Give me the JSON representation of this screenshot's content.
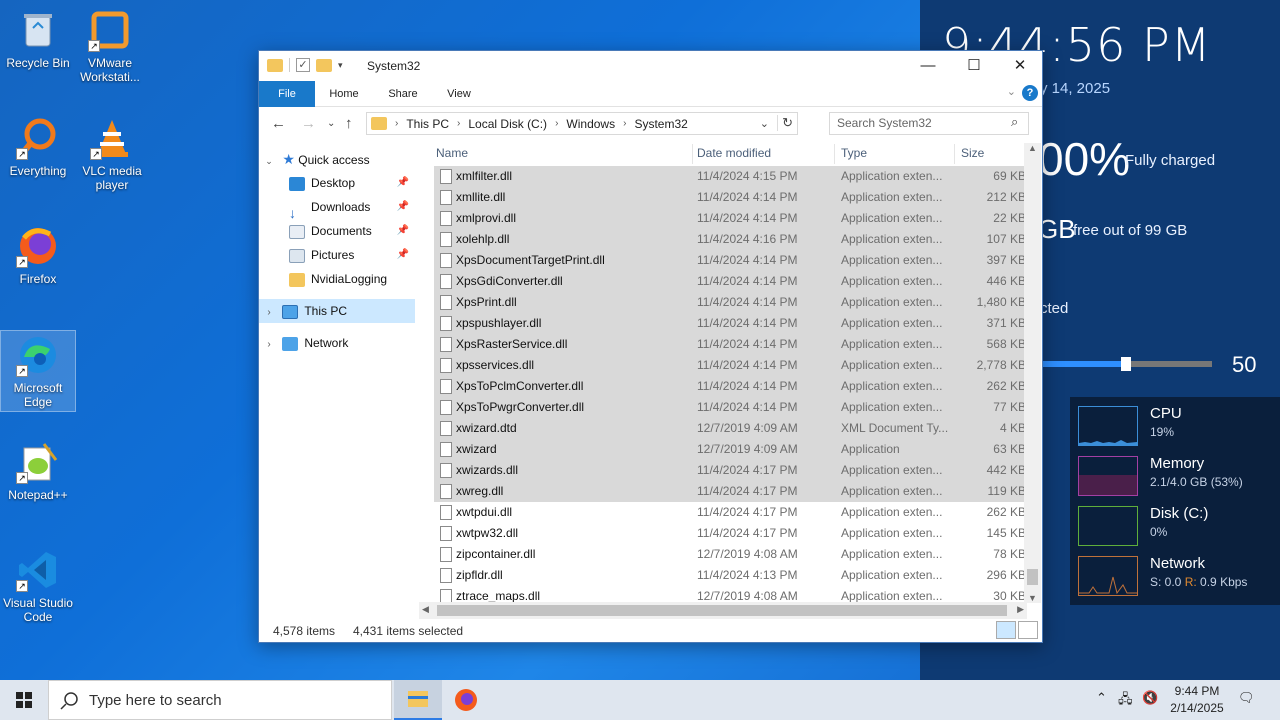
{
  "desktop": {
    "icons": [
      {
        "label": "Recycle Bin",
        "icon": "recycle-bin-icon"
      },
      {
        "label": "VMware Workstati...",
        "icon": "vmware-icon"
      },
      {
        "label": "Everything",
        "icon": "everything-search-icon"
      },
      {
        "label": "VLC media player",
        "icon": "vlc-icon"
      },
      {
        "label": "Firefox",
        "icon": "firefox-icon"
      },
      {
        "label": "Microsoft Edge",
        "icon": "edge-icon"
      },
      {
        "label": "Notepad++",
        "icon": "notepadpp-icon"
      },
      {
        "label": "Visual Studio Code",
        "icon": "vscode-icon"
      }
    ],
    "rainmeter": {
      "time": "9:44:56 PM",
      "date": "y 14, 2025",
      "battery_big": "00%",
      "battery_label": "Fully charged",
      "disk_big": "GB",
      "disk_label": "free out of 99 GB",
      "network_label": "cted",
      "volume": "50",
      "volume_fraction": 0.5
    },
    "perf": [
      {
        "name": "CPU",
        "value": "19%",
        "color": "#3b8ed8"
      },
      {
        "name": "Memory",
        "value": "2.1/4.0 GB (53%)",
        "color": "#a33fa3"
      },
      {
        "name": "Disk (C:)",
        "value": "0%",
        "color": "#5fae3b"
      },
      {
        "name": "Network",
        "value_s": "S: 0.0",
        "value_r_label": "R:",
        "value_r": "0.9 Kbps",
        "color": "#c0713a"
      }
    ]
  },
  "explorer": {
    "title": "System32",
    "ribbon_tabs": [
      "File",
      "Home",
      "Share",
      "View"
    ],
    "breadcrumb": [
      "This PC",
      "Local Disk (C:)",
      "Windows",
      "System32"
    ],
    "search_placeholder": "Search System32",
    "nav": {
      "quick_access": "Quick access",
      "items": [
        "Desktop",
        "Downloads",
        "Documents",
        "Pictures",
        "NvidiaLogging"
      ],
      "this_pc": "This PC",
      "network": "Network"
    },
    "columns": {
      "name": "Name",
      "date": "Date modified",
      "type": "Type",
      "size": "Size"
    },
    "files": [
      {
        "name": "xmlfilter.dll",
        "date": "11/4/2024 4:15 PM",
        "type": "Application exten...",
        "size": "69 KB",
        "selected": true
      },
      {
        "name": "xmllite.dll",
        "date": "11/4/2024 4:14 PM",
        "type": "Application exten...",
        "size": "212 KB",
        "selected": true
      },
      {
        "name": "xmlprovi.dll",
        "date": "11/4/2024 4:14 PM",
        "type": "Application exten...",
        "size": "22 KB",
        "selected": true
      },
      {
        "name": "xolehlp.dll",
        "date": "11/4/2024 4:16 PM",
        "type": "Application exten...",
        "size": "107 KB",
        "selected": true
      },
      {
        "name": "XpsDocumentTargetPrint.dll",
        "date": "11/4/2024 4:14 PM",
        "type": "Application exten...",
        "size": "397 KB",
        "selected": true
      },
      {
        "name": "XpsGdiConverter.dll",
        "date": "11/4/2024 4:14 PM",
        "type": "Application exten...",
        "size": "446 KB",
        "selected": true
      },
      {
        "name": "XpsPrint.dll",
        "date": "11/4/2024 4:14 PM",
        "type": "Application exten...",
        "size": "1,480 KB",
        "selected": true
      },
      {
        "name": "xpspushlayer.dll",
        "date": "11/4/2024 4:14 PM",
        "type": "Application exten...",
        "size": "371 KB",
        "selected": true
      },
      {
        "name": "XpsRasterService.dll",
        "date": "11/4/2024 4:14 PM",
        "type": "Application exten...",
        "size": "568 KB",
        "selected": true
      },
      {
        "name": "xpsservices.dll",
        "date": "11/4/2024 4:14 PM",
        "type": "Application exten...",
        "size": "2,778 KB",
        "selected": true
      },
      {
        "name": "XpsToPclmConverter.dll",
        "date": "11/4/2024 4:14 PM",
        "type": "Application exten...",
        "size": "262 KB",
        "selected": true
      },
      {
        "name": "XpsToPwgrConverter.dll",
        "date": "11/4/2024 4:14 PM",
        "type": "Application exten...",
        "size": "77 KB",
        "selected": true
      },
      {
        "name": "xwizard.dtd",
        "date": "12/7/2019 4:09 AM",
        "type": "XML Document Ty...",
        "size": "4 KB",
        "selected": true
      },
      {
        "name": "xwizard",
        "date": "12/7/2019 4:09 AM",
        "type": "Application",
        "size": "63 KB",
        "selected": true
      },
      {
        "name": "xwizards.dll",
        "date": "11/4/2024 4:17 PM",
        "type": "Application exten...",
        "size": "442 KB",
        "selected": true
      },
      {
        "name": "xwreg.dll",
        "date": "11/4/2024 4:17 PM",
        "type": "Application exten...",
        "size": "119 KB",
        "selected": true
      },
      {
        "name": "xwtpdui.dll",
        "date": "11/4/2024 4:17 PM",
        "type": "Application exten...",
        "size": "262 KB",
        "selected": false
      },
      {
        "name": "xwtpw32.dll",
        "date": "11/4/2024 4:17 PM",
        "type": "Application exten...",
        "size": "145 KB",
        "selected": false
      },
      {
        "name": "zipcontainer.dll",
        "date": "12/7/2019 4:08 AM",
        "type": "Application exten...",
        "size": "78 KB",
        "selected": false
      },
      {
        "name": "zipfldr.dll",
        "date": "11/4/2024 4:13 PM",
        "type": "Application exten...",
        "size": "296 KB",
        "selected": false
      },
      {
        "name": "ztrace_maps.dll",
        "date": "12/7/2019 4:08 AM",
        "type": "Application exten...",
        "size": "30 KB",
        "selected": false
      }
    ],
    "status_items": "4,578 items",
    "status_selected": "4,431 items selected"
  },
  "taskbar": {
    "search_placeholder": "Type here to search",
    "time": "9:44 PM",
    "date": "2/14/2025"
  }
}
